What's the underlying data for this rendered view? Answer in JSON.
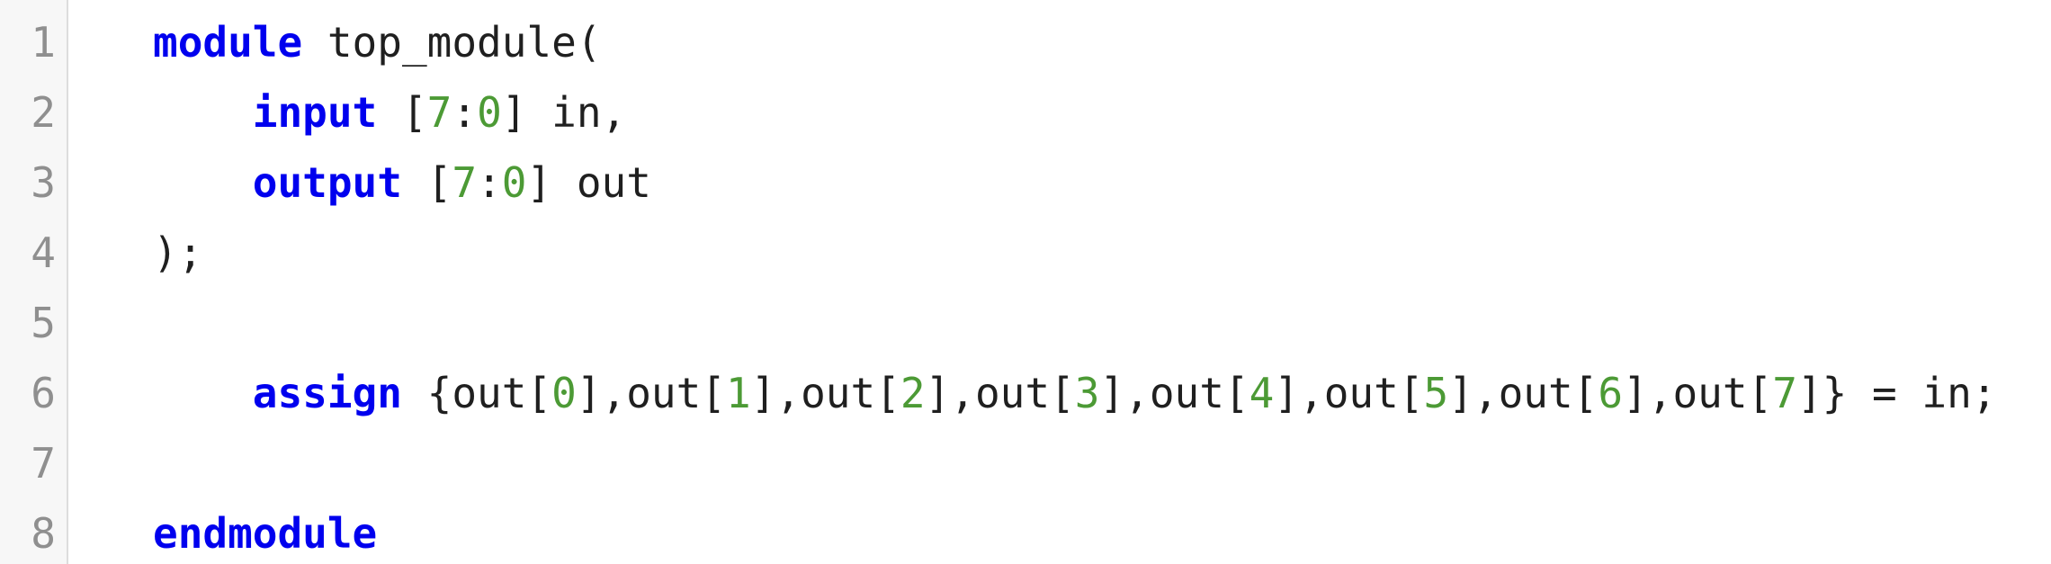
{
  "editor": {
    "line_numbers": [
      "1",
      "2",
      "3",
      "4",
      "5",
      "6",
      "7",
      "8"
    ],
    "lines": [
      [
        {
          "text": "module",
          "type": "keyword"
        },
        {
          "text": " top_module(",
          "type": "plain"
        }
      ],
      [
        {
          "text": "    ",
          "type": "plain"
        },
        {
          "text": "input",
          "type": "keyword"
        },
        {
          "text": " [",
          "type": "plain"
        },
        {
          "text": "7",
          "type": "number"
        },
        {
          "text": ":",
          "type": "plain"
        },
        {
          "text": "0",
          "type": "number"
        },
        {
          "text": "] in,",
          "type": "plain"
        }
      ],
      [
        {
          "text": "    ",
          "type": "plain"
        },
        {
          "text": "output",
          "type": "keyword"
        },
        {
          "text": " [",
          "type": "plain"
        },
        {
          "text": "7",
          "type": "number"
        },
        {
          "text": ":",
          "type": "plain"
        },
        {
          "text": "0",
          "type": "number"
        },
        {
          "text": "] out",
          "type": "plain"
        }
      ],
      [
        {
          "text": ");",
          "type": "plain"
        }
      ],
      [],
      [
        {
          "text": "    ",
          "type": "plain"
        },
        {
          "text": "assign",
          "type": "keyword"
        },
        {
          "text": " {out[",
          "type": "plain"
        },
        {
          "text": "0",
          "type": "number"
        },
        {
          "text": "],out[",
          "type": "plain"
        },
        {
          "text": "1",
          "type": "number"
        },
        {
          "text": "],out[",
          "type": "plain"
        },
        {
          "text": "2",
          "type": "number"
        },
        {
          "text": "],out[",
          "type": "plain"
        },
        {
          "text": "3",
          "type": "number"
        },
        {
          "text": "],out[",
          "type": "plain"
        },
        {
          "text": "4",
          "type": "number"
        },
        {
          "text": "],out[",
          "type": "plain"
        },
        {
          "text": "5",
          "type": "number"
        },
        {
          "text": "],out[",
          "type": "plain"
        },
        {
          "text": "6",
          "type": "number"
        },
        {
          "text": "],out[",
          "type": "plain"
        },
        {
          "text": "7",
          "type": "number"
        },
        {
          "text": "]} = in;",
          "type": "plain"
        }
      ],
      [],
      [
        {
          "text": "endmodule",
          "type": "keyword"
        }
      ]
    ]
  },
  "colors": {
    "keyword": "#0000ee",
    "number": "#4c9a35",
    "plain": "#1f1f1f",
    "line_number": "#8f8f8f",
    "gutter_background": "#f7f7f7",
    "gutter_border": "#dddddd"
  }
}
